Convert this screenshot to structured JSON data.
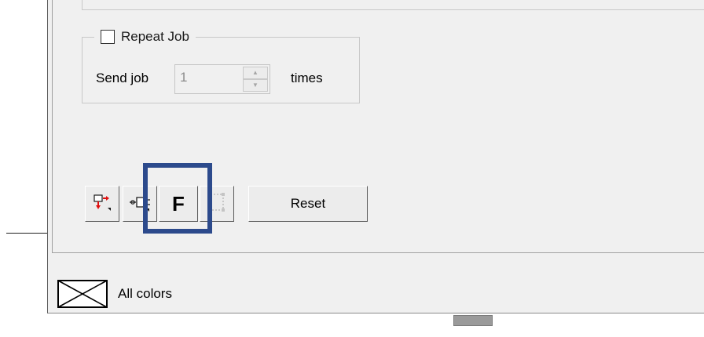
{
  "repeat_job": {
    "checkbox_label": "Repeat Job",
    "checked": false,
    "send_job_label": "Send job",
    "times_label": "times",
    "count_value": "1",
    "spin_up_glyph": "▲",
    "spin_down_glyph": "▼"
  },
  "toolbar": {
    "move_icon": "move-down-icon",
    "plug_icon": "plug-icon",
    "font_letter": "F",
    "frame_icon": "frame-icon",
    "reset_label": "Reset"
  },
  "status": {
    "icon": "no-color-swatch-icon",
    "text": "All colors"
  },
  "colors": {
    "highlight": "#2c4a8c",
    "dialog_bg": "#f0f0f0",
    "move_icon_red": "#e01010"
  }
}
